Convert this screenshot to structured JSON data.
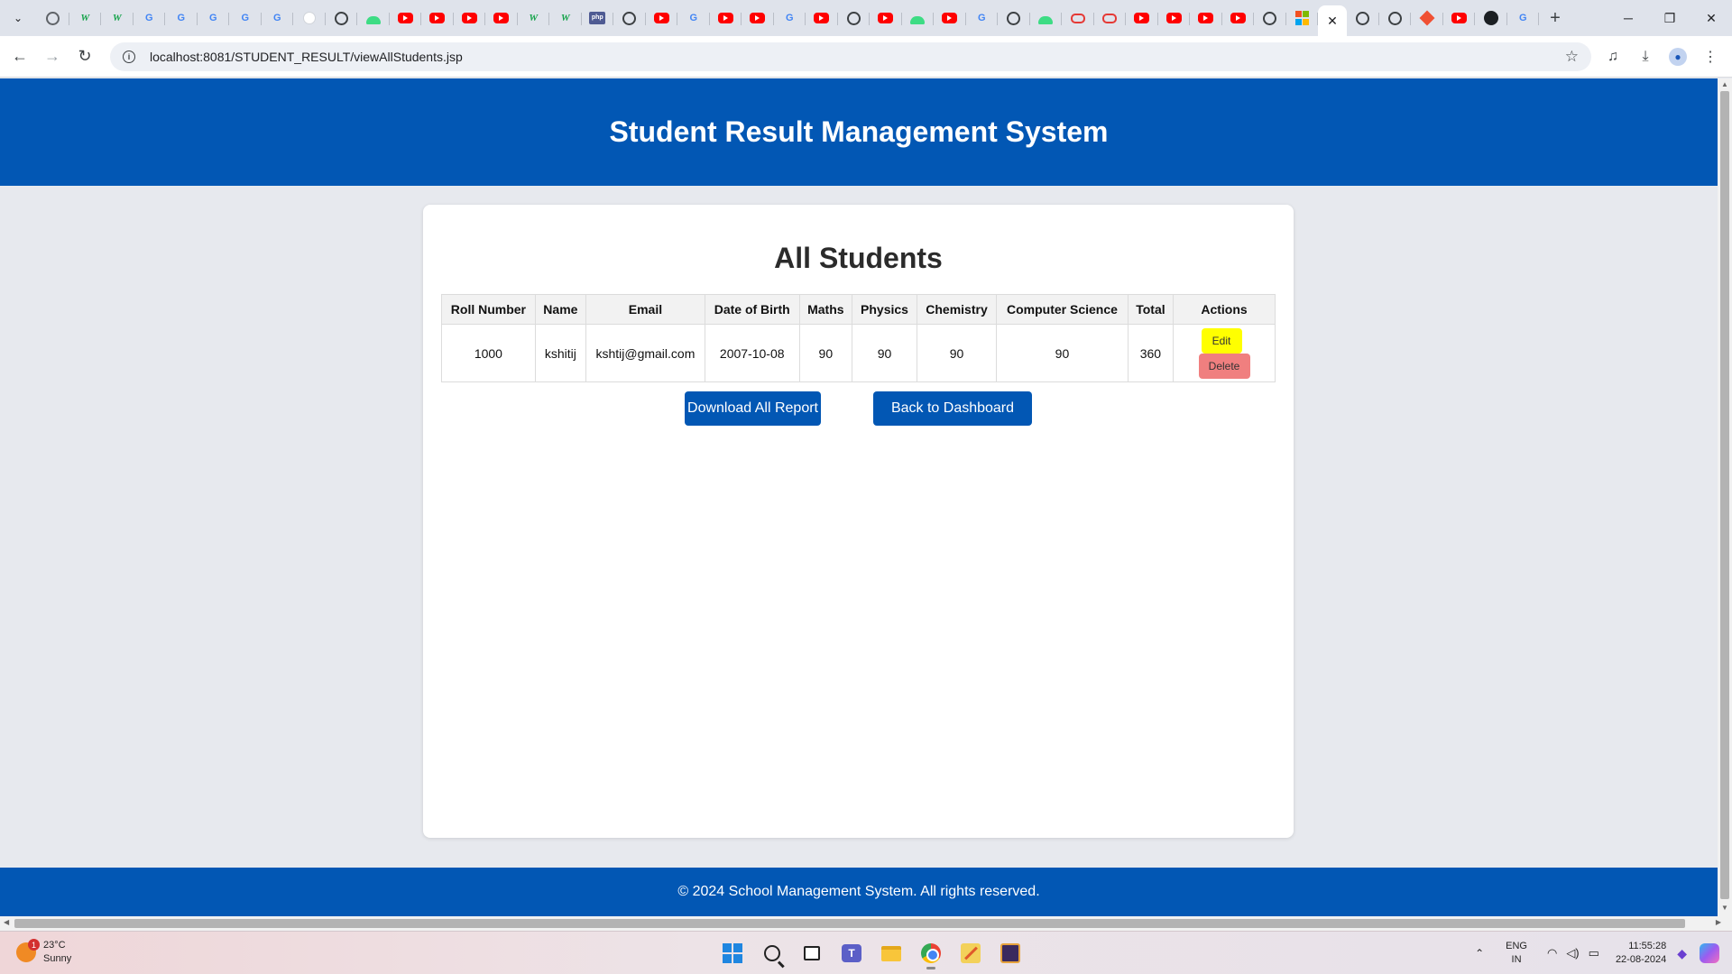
{
  "browser": {
    "url": "localhost:8081/STUDENT_RESULT/viewAllStudents.jsp",
    "close_tab_glyph": "✕",
    "new_tab_glyph": "+",
    "tab_favicons": [
      "globe-icon",
      "wiki-icon",
      "wiki-icon",
      "google-icon",
      "google-icon",
      "google-icon",
      "google-icon",
      "google-icon",
      "cloud-icon",
      "chatgpt-icon",
      "android-icon",
      "youtube-icon",
      "youtube-icon",
      "youtube-icon",
      "youtube-icon",
      "wiki-icon",
      "wiki-icon",
      "php-icon",
      "chatgpt-icon",
      "youtube-icon",
      "google-icon",
      "youtube-icon",
      "youtube-icon",
      "google-icon",
      "youtube-icon",
      "chatgpt-icon",
      "youtube-icon",
      "android-icon",
      "youtube-icon",
      "google-icon",
      "chatgpt-icon",
      "android-icon",
      "ring-icon",
      "ring-icon",
      "youtube-icon",
      "youtube-icon",
      "youtube-icon",
      "youtube-icon",
      "chatgpt-icon",
      "microsoft-icon"
    ],
    "tab_favicons_after_active": [
      "chatgpt-icon",
      "chatgpt-icon",
      "git-icon",
      "youtube-icon",
      "github-icon",
      "google-icon"
    ]
  },
  "site": {
    "header_title": "Student Result Management System",
    "page_title": "All Students",
    "footer_text": "© 2024 School Management System. All rights reserved."
  },
  "table": {
    "headers": [
      "Roll Number",
      "Name",
      "Email",
      "Date of Birth",
      "Maths",
      "Physics",
      "Chemistry",
      "Computer Science",
      "Total",
      "Actions"
    ],
    "rows": [
      {
        "roll_number": "1000",
        "name": "kshitij",
        "email": "kshtij@gmail.com",
        "dob": "2007-10-08",
        "maths": "90",
        "physics": "90",
        "chemistry": "90",
        "computer_science": "90",
        "total": "360",
        "edit_label": "Edit",
        "delete_label": "Delete"
      }
    ]
  },
  "actions": {
    "download_label": "Download All Report",
    "back_label": "Back to Dashboard"
  },
  "taskbar": {
    "weather_temp": "23°C",
    "weather_desc": "Sunny",
    "weather_badge": "1",
    "lang_top": "ENG",
    "lang_bottom": "IN",
    "time": "11:55:28",
    "date": "22-08-2024"
  },
  "colors": {
    "primary": "#0257b4",
    "edit_button": "#ffff00",
    "delete_button": "#f07f7f"
  }
}
